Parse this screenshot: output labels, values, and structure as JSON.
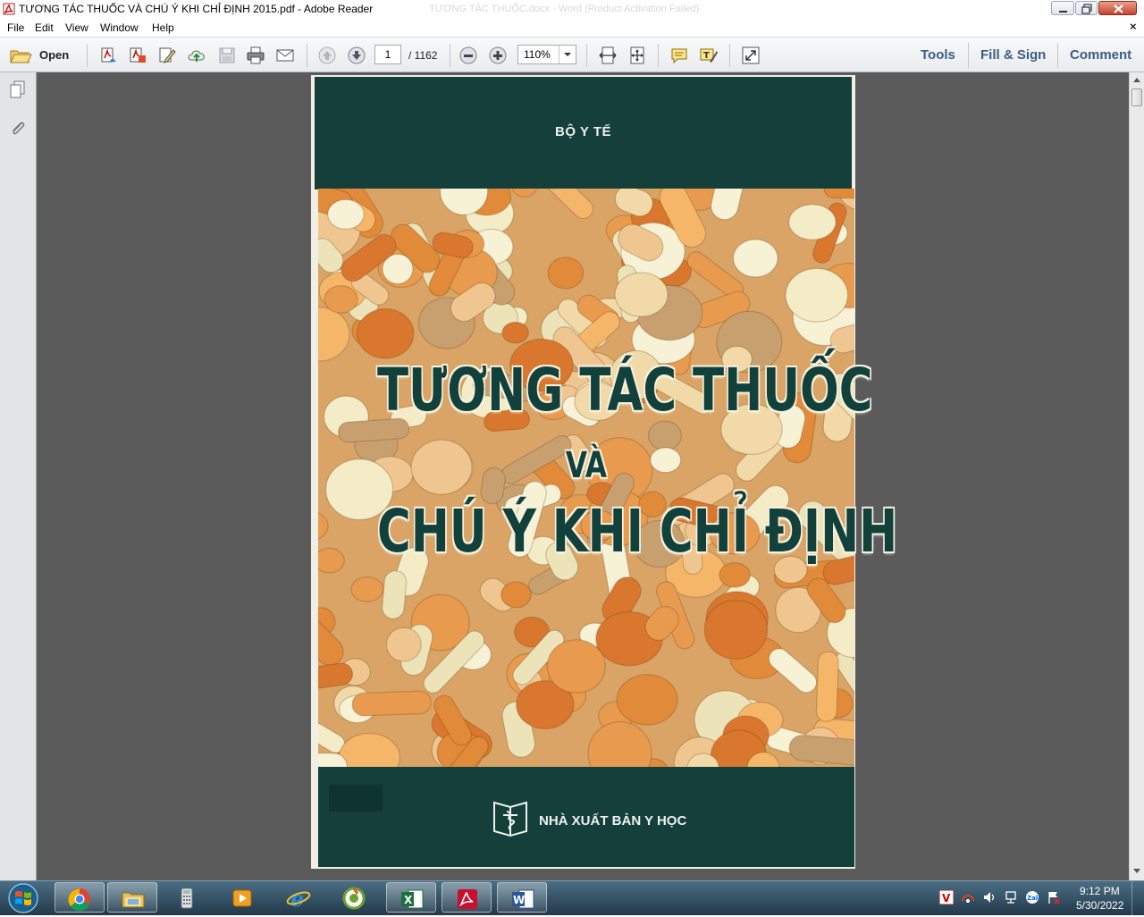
{
  "window": {
    "title": "TƯƠNG TÁC THUỐC VÀ CHÚ Ý KHI CHỈ ĐỊNH 2015.pdf - Adobe Reader",
    "background_title": "TƯƠNG TÁC THUỐC.docx - Word (Product Activation Failed)"
  },
  "menu": {
    "items": [
      "File",
      "Edit",
      "View",
      "Window",
      "Help"
    ],
    "close_glyph": "×"
  },
  "toolbar": {
    "open_label": "Open",
    "page_number": "1",
    "page_total": "/ 1162",
    "zoom": "110%",
    "tools_label": "Tools",
    "fill_sign_label": "Fill & Sign",
    "comment_label": "Comment"
  },
  "document": {
    "author": "BỘ Y TẾ",
    "title_line1": "TƯƠNG TÁC THUỐC",
    "title_line2": "VÀ",
    "title_line3": "CHÚ Ý KHI CHỈ ĐỊNH",
    "publisher": "NHÀ XUẤT BẢN Y HỌC"
  },
  "taskbar": {
    "apps": [
      "chrome-icon",
      "file-explorer-icon",
      "calculator-icon",
      "media-player-icon",
      "internet-explorer-icon",
      "corel-icon",
      "excel-icon",
      "acrobat-icon",
      "word-icon"
    ],
    "clock_time": "9:12 PM",
    "clock_date": "5/30/2022"
  },
  "colors": {
    "cover_green": "#143f3a",
    "link_blue": "#3c5d86",
    "doc_background": "#5b5b5b"
  }
}
